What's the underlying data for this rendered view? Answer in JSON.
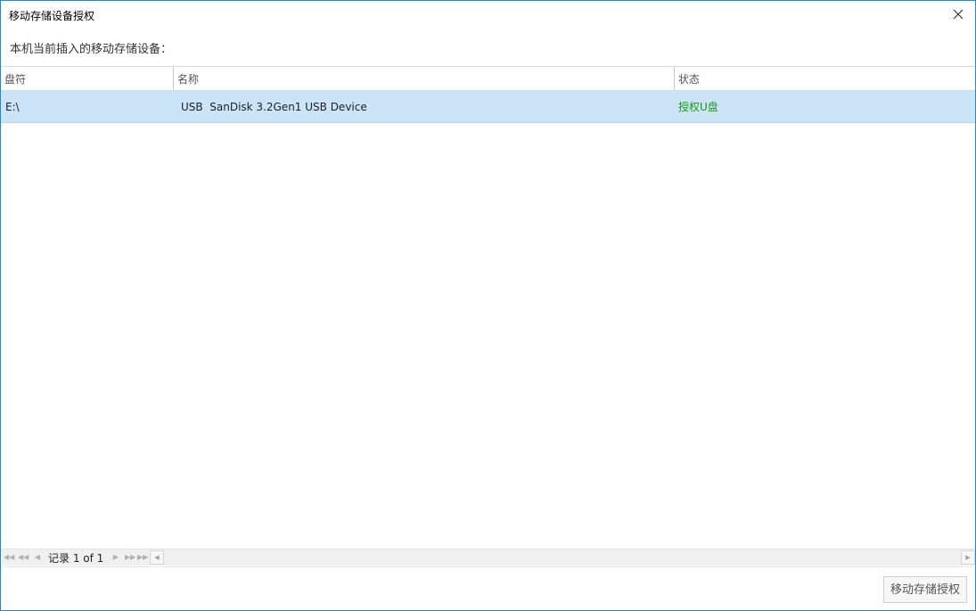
{
  "window": {
    "title": "移动存储设备授权",
    "close_icon": "close-icon"
  },
  "subtitle": "本机当前插入的移动存储设备：",
  "table": {
    "columns": [
      "盘符",
      "名称",
      "状态"
    ],
    "rows": [
      {
        "drive": "E:\\",
        "name": "USB  SanDisk 3.2Gen1 USB Device",
        "status": "授权U盘",
        "selected": true
      }
    ]
  },
  "pager": {
    "record_text": "记录 1 of 1",
    "icons": [
      "first-page-icon",
      "prev-page-fast-icon",
      "prev-page-icon",
      "next-page-icon",
      "next-page-fast-icon",
      "last-page-icon"
    ]
  },
  "footer": {
    "authorize_label": "移动存储授权"
  },
  "colors": {
    "selected_row": "#cce4f7",
    "status_green": "#1a9a1a",
    "window_border": "#3c7fb1"
  }
}
